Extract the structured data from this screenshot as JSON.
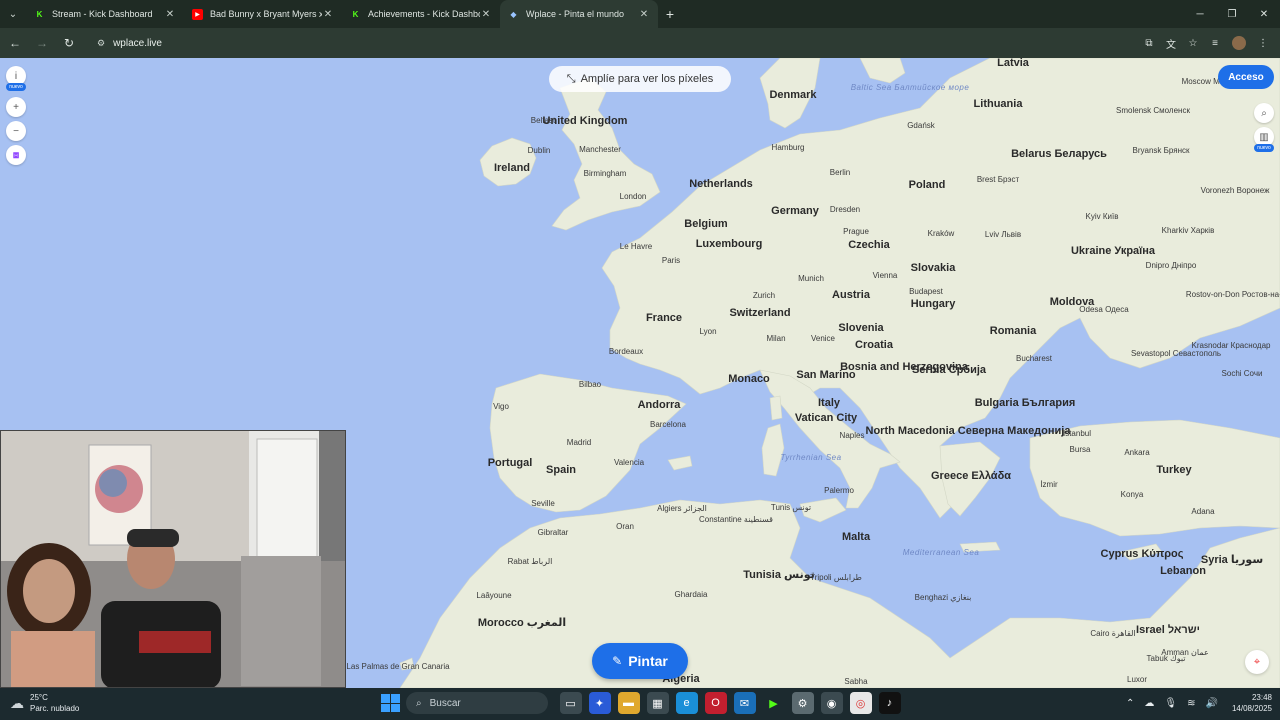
{
  "browser": {
    "tabs": [
      {
        "title": "Stream - Kick Dashboard",
        "icon": "kick-icon",
        "active": false
      },
      {
        "title": "Bad Bunny x Bryant Myers x Zio",
        "icon": "youtube-icon",
        "active": false
      },
      {
        "title": "Achievements - Kick Dashboard",
        "icon": "kick-icon",
        "active": false
      },
      {
        "title": "Wplace - Pinta el mundo",
        "icon": "wplace-icon",
        "active": true
      }
    ],
    "url": "wplace.live"
  },
  "map_ui": {
    "zoom_hint": "Amplíe para ver los píxeles",
    "login_label": "Acceso",
    "new_badge": "nuevo",
    "paint_label": "Pintar"
  },
  "map_labels": {
    "countries": [
      {
        "text": "United Kingdom"
      },
      {
        "text": "Ireland"
      },
      {
        "text": "Denmark"
      },
      {
        "text": "Latvia"
      },
      {
        "text": "Lithuania"
      },
      {
        "text": "Belarus Беларусь"
      },
      {
        "text": "Poland"
      },
      {
        "text": "Germany"
      },
      {
        "text": "Belgium"
      },
      {
        "text": "Netherlands"
      },
      {
        "text": "Luxembourg"
      },
      {
        "text": "France"
      },
      {
        "text": "Switzerland"
      },
      {
        "text": "Austria"
      },
      {
        "text": "Czechia"
      },
      {
        "text": "Slovakia"
      },
      {
        "text": "Hungary"
      },
      {
        "text": "Slovenia"
      },
      {
        "text": "Croatia"
      },
      {
        "text": "Ukraine Україна"
      },
      {
        "text": "Moldova"
      },
      {
        "text": "Romania"
      },
      {
        "text": "Bosnia and Herzegovina"
      },
      {
        "text": "Serbia Србија"
      },
      {
        "text": "Bulgaria България"
      },
      {
        "text": "North Macedonia Северна Македонија"
      },
      {
        "text": "Greece Ελλάδα"
      },
      {
        "text": "Italy"
      },
      {
        "text": "Vatican City"
      },
      {
        "text": "San Marino"
      },
      {
        "text": "Monaco"
      },
      {
        "text": "Andorra"
      },
      {
        "text": "Portugal"
      },
      {
        "text": "Spain"
      },
      {
        "text": "Morocco المغرب"
      },
      {
        "text": "Tunisia تونس"
      },
      {
        "text": "Turkey"
      },
      {
        "text": "Syria سوريا"
      },
      {
        "text": "Cyprus Κύπρος"
      },
      {
        "text": "Lebanon"
      },
      {
        "text": "Israel ישראל"
      },
      {
        "text": "Algeria"
      },
      {
        "text": "Malta"
      }
    ],
    "cities": [
      {
        "text": "Belfast"
      },
      {
        "text": "Dublin"
      },
      {
        "text": "Manchester"
      },
      {
        "text": "Birmingham"
      },
      {
        "text": "London"
      },
      {
        "text": "Hamburg"
      },
      {
        "text": "Berlin"
      },
      {
        "text": "Gdańsk"
      },
      {
        "text": "Dresden"
      },
      {
        "text": "Prague"
      },
      {
        "text": "Kraków"
      },
      {
        "text": "Munich"
      },
      {
        "text": "Vienna"
      },
      {
        "text": "Budapest"
      },
      {
        "text": "Zurich"
      },
      {
        "text": "Milan"
      },
      {
        "text": "Venice"
      },
      {
        "text": "Paris"
      },
      {
        "text": "Le Havre"
      },
      {
        "text": "Lyon"
      },
      {
        "text": "Bordeaux"
      },
      {
        "text": "Bilbao"
      },
      {
        "text": "Vigo"
      },
      {
        "text": "Madrid"
      },
      {
        "text": "Barcelona"
      },
      {
        "text": "Valencia"
      },
      {
        "text": "Seville"
      },
      {
        "text": "Gibraltar"
      },
      {
        "text": "Rabat الرباط"
      },
      {
        "text": "Oran"
      },
      {
        "text": "Algiers الجزائر"
      },
      {
        "text": "Constantine قسنطينة"
      },
      {
        "text": "Tunis تونس"
      },
      {
        "text": "Tripoli طرابلس"
      },
      {
        "text": "Naples"
      },
      {
        "text": "Palermo"
      },
      {
        "text": "Bucharest"
      },
      {
        "text": "Odesa Одеса"
      },
      {
        "text": "Kyiv Київ"
      },
      {
        "text": "Moscow Москва"
      },
      {
        "text": "Smolensk Смоленск"
      },
      {
        "text": "Bryansk Брянск"
      },
      {
        "text": "Voronezh Воронеж"
      },
      {
        "text": "Kharkiv Харків"
      },
      {
        "text": "Dnipro Дніпро"
      },
      {
        "text": "Rostov-on-Don Ростов-на-Дону"
      },
      {
        "text": "Sevastopol Севастополь"
      },
      {
        "text": "Krasnodar Краснодар"
      },
      {
        "text": "Brest Брэст"
      },
      {
        "text": "Lviv Львів"
      },
      {
        "text": "Istanbul"
      },
      {
        "text": "Bursa"
      },
      {
        "text": "Ankara"
      },
      {
        "text": "Konya"
      },
      {
        "text": "Adana"
      },
      {
        "text": "İzmir"
      },
      {
        "text": "Cairo القاهرة"
      },
      {
        "text": "Amman عمان"
      },
      {
        "text": "Benghazi بنغازي"
      },
      {
        "text": "Ghardaia"
      },
      {
        "text": "Laâyoune"
      },
      {
        "text": "Las Palmas de Gran Canaria"
      },
      {
        "text": "Tabuk تبوك"
      },
      {
        "text": "Sabha"
      },
      {
        "text": "Luxor"
      },
      {
        "text": "Sochi Сочи"
      }
    ],
    "seas": [
      {
        "text": "Baltic Sea Балтийское море"
      },
      {
        "text": "Tyrrhenian Sea"
      },
      {
        "text": "Mediterranean Sea"
      }
    ]
  },
  "taskbar": {
    "temp": "25°C",
    "weather": "Parc. nublado",
    "search_placeholder": "Buscar",
    "time": "23:48",
    "date": "14/08/2025"
  },
  "colors": {
    "sea": "#a7c1f2",
    "land": "#e9ecdc",
    "accent": "#1e6fe8"
  }
}
